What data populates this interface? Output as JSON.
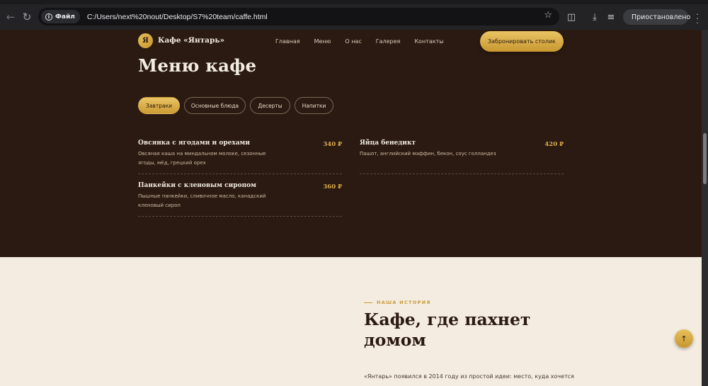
{
  "browser": {
    "site_chip_label": "Файл",
    "url": "C:/Users/next%20nout/Desktop/S7%20team/caffe.html",
    "profile_label": "Приостановлено"
  },
  "header": {
    "logo_letter": "Я",
    "brand": "Кафе «Янтарь»",
    "nav": [
      "Главная",
      "Меню",
      "О нас",
      "Галерея",
      "Контакты"
    ],
    "reserve_label": "Забронировать столик"
  },
  "menu": {
    "title": "Меню кафе",
    "tabs": [
      "Завтраки",
      "Основные блюда",
      "Десерты",
      "Напитки"
    ],
    "active_tab": "Завтраки",
    "items": [
      {
        "name": "Овсянка с ягодами и орехами",
        "price": "340 ₽",
        "description": "Овсяная каша на миндальном молоке, сезонные ягоды, мёд, грецкий орех"
      },
      {
        "name": "Яйца бенедикт",
        "price": "420 ₽",
        "description": "Пашот, английский маффин, бекон, соус голландез"
      },
      {
        "name": "Панкейки с кленовым сиропом",
        "price": "360 ₽",
        "description": "Пышные панкейки, сливочное масло, канадский кленовый сироп"
      }
    ]
  },
  "about": {
    "eyebrow": "НАША ИСТОРИЯ",
    "title": "Кафе, где пахнет домом",
    "text": "«Янтарь» появился в 2014 году из простой идеи: место, куда хочется"
  },
  "colors": {
    "dark_bg": "#2b1a12",
    "light_bg": "#f4ece1",
    "accent_gold": "#dcae4c"
  },
  "icons": {
    "back": "arrow-left-icon",
    "reload": "reload-icon",
    "info": "info-icon",
    "bookmark": "star-icon",
    "extensions": "puzzle-icon",
    "downloads": "download-icon",
    "media": "media-queue-icon",
    "menu": "kebab-menu-icon",
    "scroll_top": "arrow-up-icon"
  }
}
